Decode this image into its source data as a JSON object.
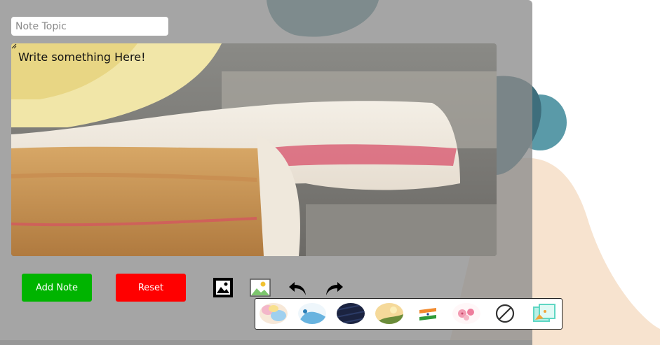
{
  "note": {
    "topic_placeholder": "Note Topic",
    "body_placeholder": "Write something Here!"
  },
  "buttons": {
    "add_note": "Add Note",
    "reset": "Reset"
  },
  "toolbar": {
    "icons": [
      "image-icon",
      "background-image-icon",
      "undo-icon",
      "redo-icon"
    ]
  },
  "background_options": [
    "watercolor-swatch",
    "blue-splash-swatch",
    "navy-pattern-swatch",
    "sunset-hills-swatch",
    "india-flag-swatch",
    "flowers-swatch",
    "no-background-icon",
    "custom-image-icon"
  ],
  "colors": {
    "add_note": "#00b400",
    "reset": "#ff0000",
    "panel_overlay": "#8c8c8c"
  }
}
